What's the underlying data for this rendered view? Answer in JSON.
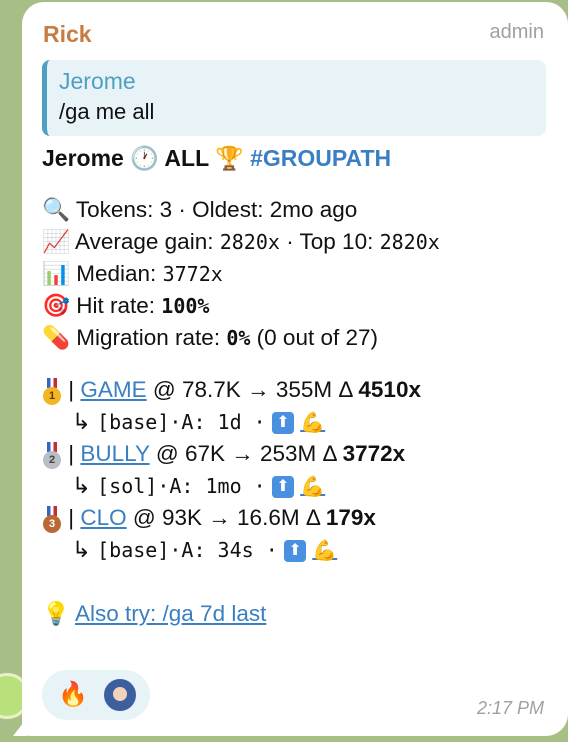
{
  "message": {
    "sender": "Rick",
    "role": "admin",
    "reply": {
      "name": "Jerome",
      "text": "/ga me all"
    },
    "header": {
      "name": "Jerome",
      "clock": "🕐",
      "scope": "ALL",
      "trophy": "🏆",
      "hashtag": "#GROUPATH"
    },
    "stats": [
      {
        "icon": "🔍",
        "text_a": "Tokens: 3 · Oldest: 2mo ago"
      },
      {
        "icon": "📈",
        "prefix": "Average gain: ",
        "val1": "2820x",
        "mid": " · Top 10: ",
        "val2": "2820x"
      },
      {
        "icon": "📊",
        "prefix": "Median: ",
        "val1": "3772x"
      },
      {
        "icon": "🎯",
        "prefix": "Hit rate: ",
        "val1": "100%"
      },
      {
        "icon": "💊",
        "prefix": "Migration rate: ",
        "val1": "0%",
        "suffix": " (0 out of 27)"
      }
    ],
    "tokens": [
      {
        "rank": "1",
        "name": "GAME",
        "at": " @ 78.7K ",
        "arrow": "→",
        "to": " 355M ",
        "delta": "Δ ",
        "mult": "4510x",
        "sub": "[base]·A: 1d ·"
      },
      {
        "rank": "2",
        "name": "BULLY",
        "at": " @ 67K ",
        "arrow": "→",
        "to": " 253M ",
        "delta": "Δ ",
        "mult": "3772x",
        "sub": "[sol]·A: 1mo ·"
      },
      {
        "rank": "3",
        "name": "CLO",
        "at": " @ 93K ",
        "arrow": "→",
        "to": " 16.6M ",
        "delta": "Δ ",
        "mult": "179x",
        "sub": "[base]·A: 34s ·"
      }
    ],
    "sub_arrow": "↳",
    "rank_sep": "|",
    "up_icon": "⬆",
    "flex_icon": "💪",
    "also_try": {
      "icon": "💡",
      "text": "Also try: /ga 7d last"
    },
    "reactions": {
      "fire": "🔥"
    },
    "time": "2:17 PM"
  }
}
